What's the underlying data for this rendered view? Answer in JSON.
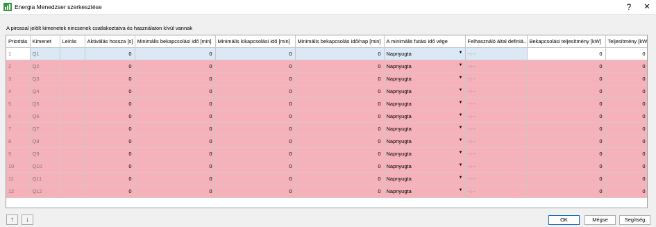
{
  "window": {
    "title": "Energia Menedzser szerkesztése",
    "help_glyph": "?",
    "close_glyph": "✕"
  },
  "notice": "A pirossal jelölt kimenetek nincsenek csatlakoztatva és használaton kívül vannak",
  "colors": {
    "unconnected_row": "#f6b2bb",
    "selected_cell": "#dbe9f7",
    "ok_border": "#0a64c8"
  },
  "columns": [
    "Prioritás",
    "Kimenet",
    "Leírás",
    "Aktiválás hossza [s]",
    "Minimális bekapcsolási idő [min]",
    "Minimális kikapcsolási idő [min]",
    "Minimális bekapcsolás idő/nap [min]",
    "A minimális futási idő vége",
    "Felhasználó által definiá...",
    "Bekapcsolási teljesítmény [kW]",
    "Teljesítmény [kW]"
  ],
  "rows": [
    {
      "prio": "1",
      "output": "Q1",
      "desc": "",
      "act": "0",
      "min_on": "0",
      "min_off": "0",
      "min_day": "0",
      "end": "Napnyugta",
      "user": "--:--",
      "power_on": "0",
      "power": "0"
    },
    {
      "prio": "2",
      "output": "Q2",
      "desc": "",
      "act": "0",
      "min_on": "0",
      "min_off": "0",
      "min_day": "0",
      "end": "Napnyugta",
      "user": "--:--",
      "power_on": "0",
      "power": "0"
    },
    {
      "prio": "3",
      "output": "Q3",
      "desc": "",
      "act": "0",
      "min_on": "0",
      "min_off": "0",
      "min_day": "0",
      "end": "Napnyugta",
      "user": "--:--",
      "power_on": "0",
      "power": "0"
    },
    {
      "prio": "4",
      "output": "Q4",
      "desc": "",
      "act": "0",
      "min_on": "0",
      "min_off": "0",
      "min_day": "0",
      "end": "Napnyugta",
      "user": "--:--",
      "power_on": "0",
      "power": "0"
    },
    {
      "prio": "5",
      "output": "Q5",
      "desc": "",
      "act": "0",
      "min_on": "0",
      "min_off": "0",
      "min_day": "0",
      "end": "Napnyugta",
      "user": "--:--",
      "power_on": "0",
      "power": "0"
    },
    {
      "prio": "6",
      "output": "Q6",
      "desc": "",
      "act": "0",
      "min_on": "0",
      "min_off": "0",
      "min_day": "0",
      "end": "Napnyugta",
      "user": "--:--",
      "power_on": "0",
      "power": "0"
    },
    {
      "prio": "7",
      "output": "Q7",
      "desc": "",
      "act": "0",
      "min_on": "0",
      "min_off": "0",
      "min_day": "0",
      "end": "Napnyugta",
      "user": "--:--",
      "power_on": "0",
      "power": "0"
    },
    {
      "prio": "8",
      "output": "Q8",
      "desc": "",
      "act": "0",
      "min_on": "0",
      "min_off": "0",
      "min_day": "0",
      "end": "Napnyugta",
      "user": "--:--",
      "power_on": "0",
      "power": "0"
    },
    {
      "prio": "9",
      "output": "Q9",
      "desc": "",
      "act": "0",
      "min_on": "0",
      "min_off": "0",
      "min_day": "0",
      "end": "Napnyugta",
      "user": "--:--",
      "power_on": "0",
      "power": "0"
    },
    {
      "prio": "10",
      "output": "Q10",
      "desc": "",
      "act": "0",
      "min_on": "0",
      "min_off": "0",
      "min_day": "0",
      "end": "Napnyugta",
      "user": "--:--",
      "power_on": "0",
      "power": "0"
    },
    {
      "prio": "11",
      "output": "Q11",
      "desc": "",
      "act": "0",
      "min_on": "0",
      "min_off": "0",
      "min_day": "0",
      "end": "Napnyugta",
      "user": "--:--",
      "power_on": "0",
      "power": "0"
    },
    {
      "prio": "12",
      "output": "Q12",
      "desc": "",
      "act": "0",
      "min_on": "0",
      "min_off": "0",
      "min_day": "0",
      "end": "Napnyugta",
      "user": "--:--",
      "power_on": "0",
      "power": "0"
    }
  ],
  "nav": {
    "up_glyph": "↑",
    "down_glyph": "↓"
  },
  "buttons": {
    "ok": "OK",
    "cancel": "Mégse",
    "help": "Segítség"
  },
  "icons": {
    "app": "energy-manager-icon",
    "dropdown": "dropdown-arrow-icon"
  }
}
